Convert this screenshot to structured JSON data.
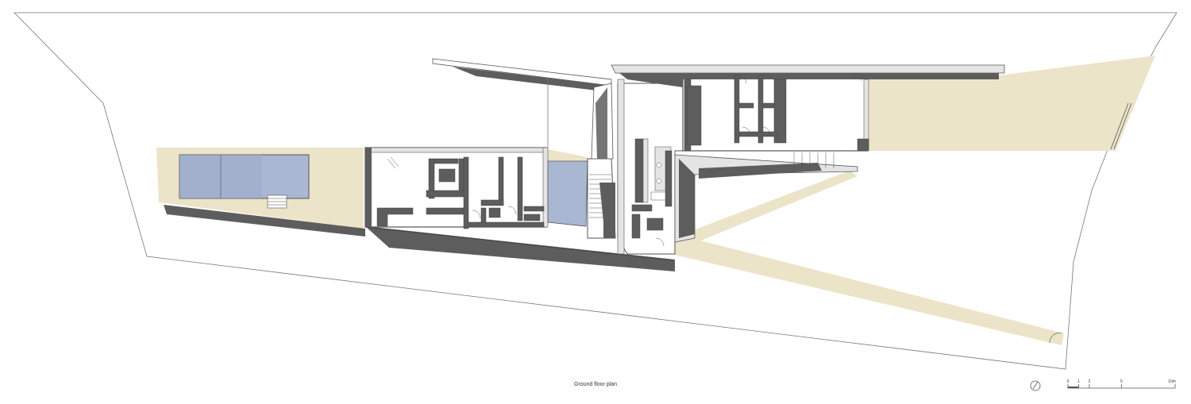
{
  "caption": "Ground floor plan",
  "scale_bar": {
    "ticks": [
      {
        "value": 0,
        "label": "0"
      },
      {
        "value": 1,
        "label": "1"
      },
      {
        "value": 2,
        "label": "2"
      },
      {
        "value": 5,
        "label": "5"
      },
      {
        "value": 10,
        "label": "10m"
      }
    ]
  },
  "colors": {
    "site_line": "#777777",
    "terrace": "#ece4c8",
    "pool_water": "#a9b7d2",
    "wall_shadow": "#5d5d5d",
    "wall": "#e4e4e4",
    "background": "#ffffff"
  }
}
